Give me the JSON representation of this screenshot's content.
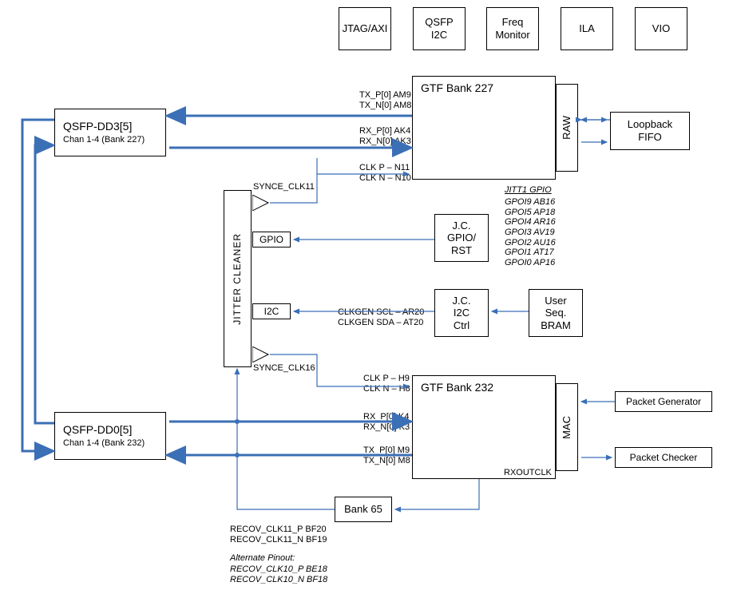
{
  "top_boxes": {
    "jtag_axi": "JTAG/AXI",
    "qsfp_i2c": "QSFP\nI2C",
    "freq_monitor": "Freq\nMonitor",
    "ila": "ILA",
    "vio": "VIO"
  },
  "qsfp_dd3": {
    "title": "QSFP-DD3[5]",
    "subtitle": "Chan 1-4 (Bank 227)"
  },
  "qsfp_dd0": {
    "title": "QSFP-DD0[5]",
    "subtitle": "Chan 1-4 (Bank 232)"
  },
  "gtf227": {
    "title": "GTF Bank 227",
    "side": "RAW"
  },
  "gtf232": {
    "title": "GTF Bank 232",
    "side": "MAC",
    "rxoutclk": "RXOUTCLK"
  },
  "jitter_cleaner": {
    "title": "JITTER CLEANER",
    "gpio": "GPIO",
    "i2c": "I2C"
  },
  "jc_gpio_rst": "J.C.\nGPIO/\nRST",
  "jc_i2c_ctrl": "J.C.\nI2C\nCtrl",
  "user_seq_bram": "User\nSeq.\nBRAM",
  "loopback_fifo": "Loopback\nFIFO",
  "packet_generator": "Packet Generator",
  "packet_checker": "Packet Checker",
  "bank65": "Bank 65",
  "signal_labels": {
    "tx227": "TX_P[0] AM9\nTX_N[0] AM8",
    "rx227": "RX_P[0] AK4\nRX_N[0] AK3",
    "clk227": "CLK P – N11\nCLK N – N10",
    "synce_clk11": "SYNCE_CLK11",
    "synce_clk16": "SYNCE_CLK16",
    "clkgen": "CLKGEN SCL – AR20\nCLKGEN SDA – AT20",
    "clk232": "CLK P – H9\nCLK N – H8",
    "rx232": "RX_P[0] K4\nRX_N[0] K3",
    "tx232": "TX_P[0] M9\nTX_N[0] M8",
    "recov_clk11": "RECOV_CLK11_P BF20\nRECOV_CLK11_N BF19",
    "jitt1_gpio_title": "JITT1 GPIO",
    "gpoi_list": "GPOI9 AB16\nGPOI5 AP18\nGPOI4 AR16\nGPOI3 AV19\nGPOI2 AU16\nGPOI1 AT17\nGPOI0 AP16",
    "alt_pinout_title": "Alternate Pinout:",
    "alt_pinout": "RECOV_CLK10_P BE18\nRECOV_CLK10_N BF18"
  }
}
